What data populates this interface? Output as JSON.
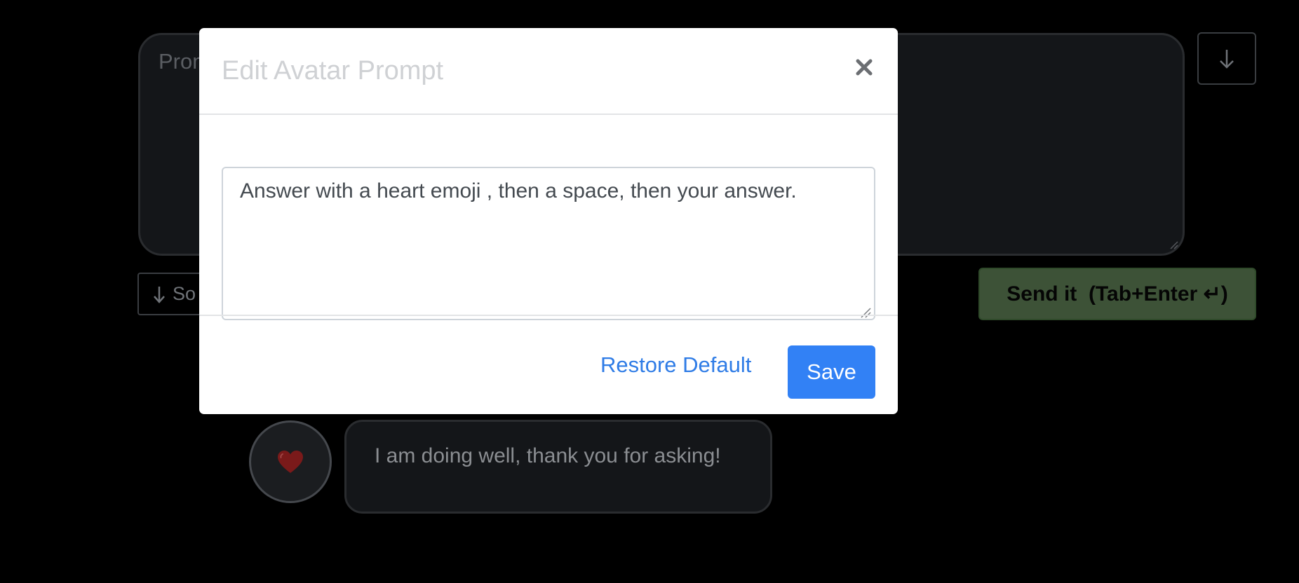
{
  "background": {
    "prompt_placeholder": "Prompt",
    "scroll_icon": "arrow-down-icon",
    "sort_label": "So",
    "send_label": "Send it  (Tab+Enter ↵)",
    "message": {
      "avatar_icon": "heart-icon",
      "text": "I am doing well, thank you for asking!"
    },
    "colors": {
      "send_bg": "#3d5237",
      "bubble_bg": "#141619"
    }
  },
  "modal": {
    "title": "Edit Avatar Prompt",
    "close_icon": "close-icon",
    "prompt_value": "Answer with a heart emoji , then a space, then your answer.",
    "restore_label": "Restore Default",
    "save_label": "Save",
    "colors": {
      "save_bg": "#3281f5",
      "link": "#2f7ce6"
    }
  }
}
